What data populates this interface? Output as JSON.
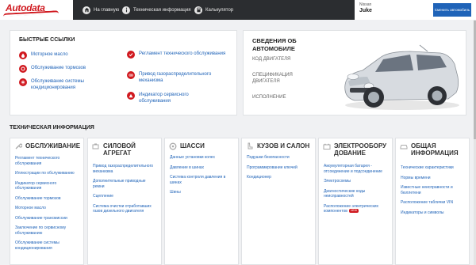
{
  "header": {
    "logo": "Autodata",
    "nav": [
      {
        "label": "На главную",
        "icon": "home-icon"
      },
      {
        "label": "Техническая информация",
        "icon": "info-icon"
      },
      {
        "label": "Калькулятор",
        "icon": "calculator-icon"
      }
    ],
    "vehicle": {
      "make": "Nissan",
      "model": "Juke"
    },
    "change_vehicle_label": "Сменить автомобиль"
  },
  "quick_links": {
    "title": "БЫСТРЫЕ ССЫЛКИ",
    "left": [
      {
        "label": "Моторное масло",
        "icon": "oil-drop-icon"
      },
      {
        "label": "Обслуживание тормозов",
        "icon": "brake-icon"
      },
      {
        "label": "Обслуживание системы кондиционирования",
        "icon": "ac-icon"
      }
    ],
    "right": [
      {
        "label": "Регламент технического обслуживания",
        "icon": "checkmark-icon"
      },
      {
        "label": "Привод газораспределительного механизма",
        "icon": "belt-icon"
      },
      {
        "label": "Индикатор сервисного обслуживания",
        "icon": "warning-icon"
      }
    ]
  },
  "vehicle_info": {
    "title": "СВЕДЕНИЯ ОБ АВТОМОБИЛЕ",
    "links": [
      "КОД ДВИГАТЕЛЯ",
      "СПЕЦИФИКАЦИЯ ДВИГАТЕЛЯ",
      "ИСПОЛНЕНИЕ"
    ]
  },
  "tech_info": {
    "title": "ТЕХНИЧЕСКАЯ ИНФОРМАЦИЯ",
    "categories": [
      {
        "title": "ОБСЛУЖИВАНИЕ",
        "icon": "wrench-icon",
        "links": [
          "Регламент технического обслуживания",
          "Иллюстрации по обслуживанию",
          "Индикатор сервисного обслуживания",
          "Обслуживание тормозов",
          "Моторное масло",
          "Обслуживание трансмиссии",
          "Заключение по сервисному обслуживанию",
          "Обслуживание системы кондиционирования"
        ]
      },
      {
        "title": "СИЛОВОЙ АГРЕГАТ",
        "icon": "engine-icon",
        "links": [
          "Привод газораспределительного механизма",
          "Дополнительные приводные ремни",
          "Сцепление",
          "Система очистки отработавших газов дизельного двигателя"
        ]
      },
      {
        "title": "ШАССИ",
        "icon": "wheel-icon",
        "links": [
          "Данные установки колес",
          "Давление в шинах",
          "Система контроля давления в шинах",
          "Шины"
        ]
      },
      {
        "title": "КУЗОВ И САЛОН",
        "icon": "seat-icon",
        "links": [
          "Подушки безопасности",
          "Программирование ключей",
          "Кондиционер"
        ]
      },
      {
        "title": "ЭЛЕКТРООБОРУ ДОВАНИЕ",
        "icon": "battery-icon",
        "links": [
          "Аккумуляторная батарея - отсоединение и подсоединение",
          "Электросхемы",
          "Диагностические коды неисправностей",
          "Расположение электрических компонентов"
        ],
        "badge": "NEW"
      },
      {
        "title": "ОБЩАЯ ИНФОРМАЦИЯ",
        "icon": "car-icon",
        "links": [
          "Технические характеристики",
          "Нормы времени",
          "Известные неисправности и бюллетени",
          "Расположение таблички VIN",
          "Индикаторы и символы"
        ]
      }
    ]
  },
  "colors": {
    "accent": "#d0191f",
    "link": "#1f63b8",
    "topbar": "#2b2d30"
  }
}
